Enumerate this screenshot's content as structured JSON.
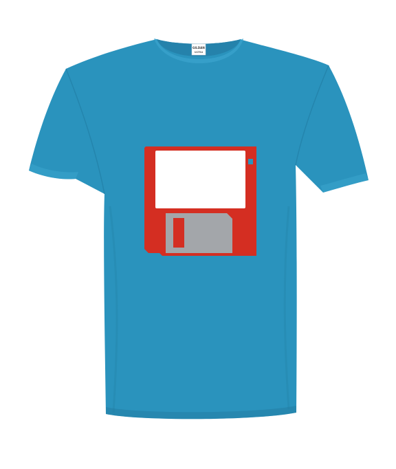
{
  "colors": {
    "background": "#ffffff",
    "shirt": "#2a93bd",
    "shirt_shadow": "#217ba1",
    "shirt_highlight": "#3aa3cc",
    "collar_inner": "#2582ab",
    "floppy_body": "#d42e22",
    "floppy_label": "#ffffff",
    "floppy_shutter": "#a3a6aa",
    "floppy_window": "#d42e22",
    "write_protect": "#2a93bd"
  },
  "icons": {
    "shirt": "t-shirt",
    "print": "floppy-disk-icon"
  },
  "tag": {
    "brand": "GILDAN",
    "size": "ULTRA"
  }
}
